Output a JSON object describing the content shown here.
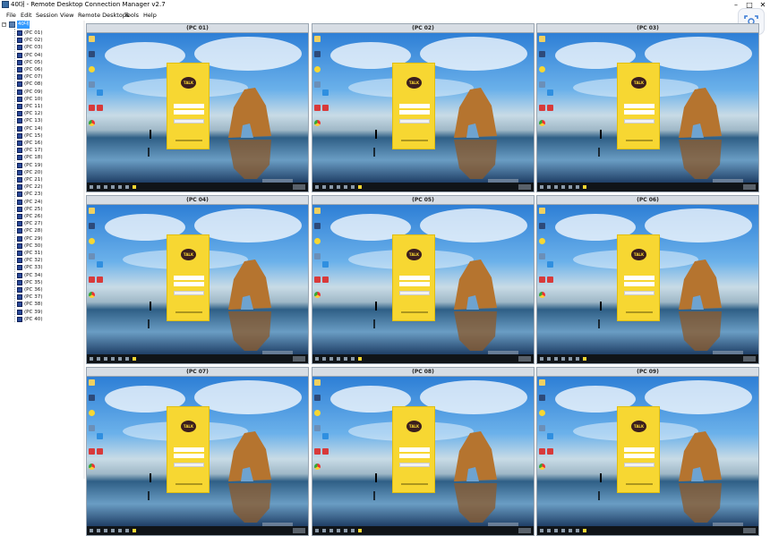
{
  "window": {
    "title": "40대 - Remote Desktop Connection Manager v2.7",
    "minimize": "–",
    "maximize": "□",
    "close": "✕"
  },
  "menu": [
    "File",
    "Edit",
    "Session",
    "View",
    "Remote Desktops",
    "Tools",
    "Help"
  ],
  "tree": {
    "root_label": "40대",
    "toggle": "−",
    "items": [
      "(PC 01)",
      "(PC 02)",
      "(PC 03)",
      "(PC 04)",
      "(PC 05)",
      "(PC 06)",
      "(PC 07)",
      "(PC 08)",
      "(PC 09)",
      "(PC 10)",
      "(PC 11)",
      "(PC 12)",
      "(PC 13)",
      "(PC 14)",
      "(PC 15)",
      "(PC 16)",
      "(PC 17)",
      "(PC 18)",
      "(PC 19)",
      "(PC 20)",
      "(PC 21)",
      "(PC 22)",
      "(PC 23)",
      "(PC 24)",
      "(PC 25)",
      "(PC 26)",
      "(PC 27)",
      "(PC 28)",
      "(PC 29)",
      "(PC 30)",
      "(PC 31)",
      "(PC 32)",
      "(PC 33)",
      "(PC 34)",
      "(PC 35)",
      "(PC 36)",
      "(PC 37)",
      "(PC 38)",
      "(PC 39)",
      "(PC 40)"
    ]
  },
  "thumbnails": [
    "(PC 01)",
    "(PC 02)",
    "(PC 03)",
    "(PC 04)",
    "(PC 05)",
    "(PC 06)",
    "(PC 07)",
    "(PC 08)",
    "(PC 09)"
  ],
  "kakao_logo": "TALK",
  "colors": {
    "selection": "#3399ff",
    "kakao_yellow": "#f7d732",
    "header_bg": "#d7dde4"
  }
}
